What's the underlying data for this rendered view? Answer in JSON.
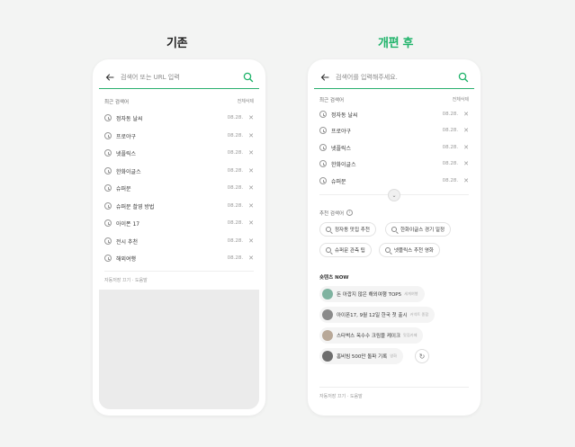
{
  "titles": {
    "before": "기존",
    "after": "개편 후"
  },
  "before": {
    "search_placeholder": "검색어 또는 URL 입력",
    "section_label": "최근 검색어",
    "clear_all": "전체삭제",
    "items": [
      {
        "label": "정자동 날씨",
        "date": "08.28."
      },
      {
        "label": "프로야구",
        "date": "08.28."
      },
      {
        "label": "넷플릭스",
        "date": "08.28."
      },
      {
        "label": "한화이글스",
        "date": "08.28."
      },
      {
        "label": "슈퍼문",
        "date": "08.28."
      },
      {
        "label": "슈퍼문 촬영 방법",
        "date": "08.28."
      },
      {
        "label": "아이폰 17",
        "date": "08.28."
      },
      {
        "label": "전시 추천",
        "date": "08.28."
      },
      {
        "label": "해외여행",
        "date": "08.28."
      }
    ],
    "footer": "자동저장 끄기 · 도움말"
  },
  "after": {
    "search_placeholder": "검색어를 입력해주세요.",
    "section_label": "최근 검색어",
    "clear_all": "전체삭제",
    "items": [
      {
        "label": "정자동 날씨",
        "date": "08.28."
      },
      {
        "label": "프로야구",
        "date": "08.28."
      },
      {
        "label": "넷플릭스",
        "date": "08.28."
      },
      {
        "label": "한화이글스",
        "date": "08.28."
      },
      {
        "label": "슈퍼문",
        "date": "08.28."
      }
    ],
    "recommend_label": "추천 검색어",
    "recommend_info": "i",
    "recommend_chips": [
      "정자동 맛집 추천",
      "한화이글스 경기 일정",
      "슈퍼문 관측 팁",
      "넷플릭스 추천 영화"
    ],
    "now_label": "숏텐츠 NOW",
    "now_items": [
      {
        "title": "돈 아깝지 않은 해외여행 TOP5",
        "source": "세계여행"
      },
      {
        "title": "아이폰17, 9월 12일 한국 첫 출시",
        "source": "커넥트 종합"
      },
      {
        "title": "스타벅스 옥수수 크림블 케이크",
        "source": "맛집카페"
      },
      {
        "title": "홈비빔 500만 돌파 기록",
        "source": "영화"
      }
    ],
    "footer": "자동저장 끄기 · 도움말"
  },
  "colors": {
    "accent": "#1fb36a",
    "page_bg": "#f3f4f3"
  }
}
